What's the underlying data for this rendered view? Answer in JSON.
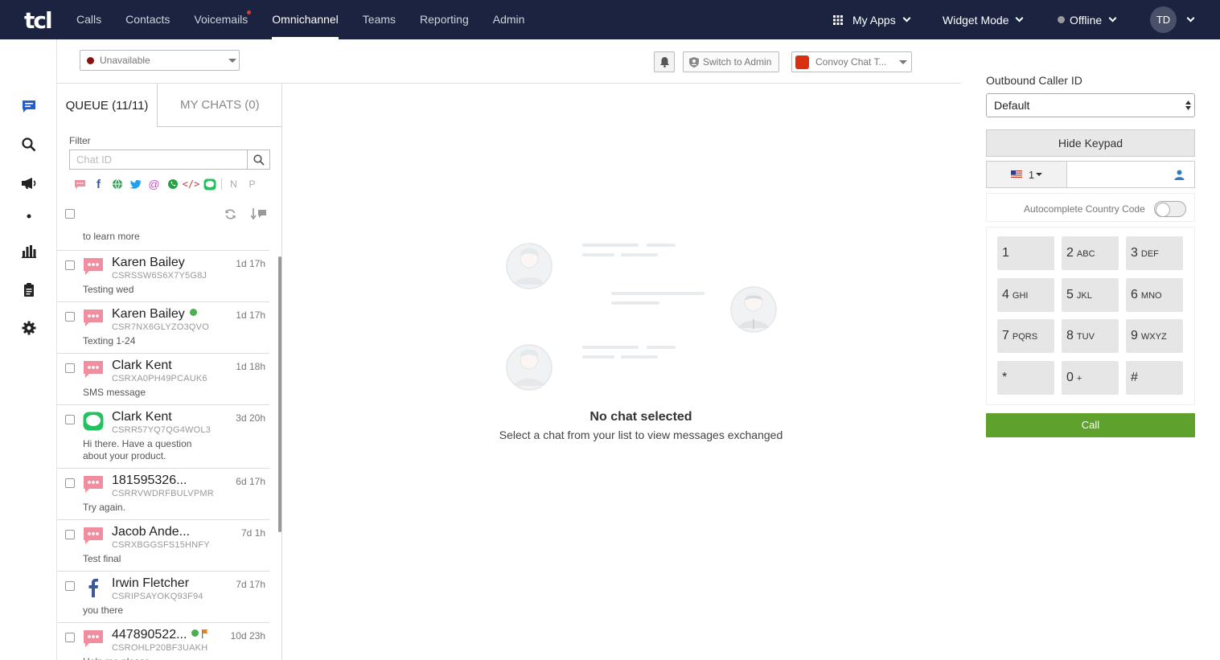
{
  "header": {
    "logo": "tcl",
    "nav": [
      "Calls",
      "Contacts",
      "Voicemails",
      "Omnichannel",
      "Teams",
      "Reporting",
      "Admin"
    ],
    "my_apps": "My Apps",
    "widget_mode": "Widget Mode",
    "status": "Offline",
    "avatar": "TD"
  },
  "toolbar": {
    "agent_status": "Unavailable",
    "switch_admin": "Switch to Admin",
    "inbox": "Convoy Chat T..."
  },
  "panel": {
    "tab_queue": "QUEUE (11/11)",
    "tab_mychats": "MY CHATS (0)",
    "filter_label": "Filter",
    "filter_placeholder": "Chat ID",
    "truncated_msg": "to learn more",
    "items": [
      {
        "name": "Karen Bailey",
        "id": "CSRSSW6S6X7Y5G8J",
        "msg": "Testing wed",
        "time": "1d 17h",
        "channel": "sms",
        "online": false
      },
      {
        "name": "Karen Bailey",
        "id": "CSR7NX6GLYZO3QVO",
        "msg": "Texting 1-24",
        "time": "1d 17h",
        "channel": "sms",
        "online": true
      },
      {
        "name": "Clark Kent",
        "id": "CSRXA0PH49PCAUK6",
        "msg": "SMS message",
        "time": "1d 18h",
        "channel": "sms",
        "online": false
      },
      {
        "name": "Clark Kent",
        "id": "CSRR57YQ7QG4WOL3",
        "msg": "Hi there. Have a question about your product.",
        "time": "3d 20h",
        "channel": "line",
        "online": false
      },
      {
        "name": "181595326...",
        "id": "CSRRVWDRFBULVPMR",
        "msg": "Try again.",
        "time": "6d 17h",
        "channel": "sms",
        "online": false
      },
      {
        "name": "Jacob Ande...",
        "id": "CSRXBGGSFS15HNFY",
        "msg": "Test final",
        "time": "7d 1h",
        "channel": "sms",
        "online": false
      },
      {
        "name": "Irwin Fletcher",
        "id": "CSRIPSAYOKQ93F94",
        "msg": "you there",
        "time": "7d 17h",
        "channel": "facebook",
        "online": false
      },
      {
        "name": "447890522...",
        "id": "CSROHLP20BF3UAKH",
        "msg": "Help me please",
        "time": "10d 23h",
        "channel": "sms",
        "online": true
      }
    ]
  },
  "center": {
    "title": "No chat selected",
    "subtitle": "Select a chat from your list to view messages exchanged"
  },
  "dialer": {
    "caller_id_label": "Outbound Caller ID",
    "caller_id_value": "Default",
    "hide_keypad": "Hide Keypad",
    "country_code": "1",
    "autocomplete_label": "Autocomplete Country Code",
    "keys": [
      {
        "d": "1",
        "l": ""
      },
      {
        "d": "2",
        "l": "ABC"
      },
      {
        "d": "3",
        "l": "DEF"
      },
      {
        "d": "4",
        "l": "GHI"
      },
      {
        "d": "5",
        "l": "JKL"
      },
      {
        "d": "6",
        "l": "MNO"
      },
      {
        "d": "7",
        "l": "PQRS"
      },
      {
        "d": "8",
        "l": "TUV"
      },
      {
        "d": "9",
        "l": "WXYZ"
      },
      {
        "d": "*",
        "l": ""
      },
      {
        "d": "0",
        "l": "+"
      },
      {
        "d": "#",
        "l": ""
      }
    ],
    "call": "Call"
  },
  "colors": {
    "topbar": "#1b2340",
    "call": "#5ea12c",
    "sms": "#f08ea0",
    "line": "#22c35e",
    "facebook": "#3b5998"
  }
}
